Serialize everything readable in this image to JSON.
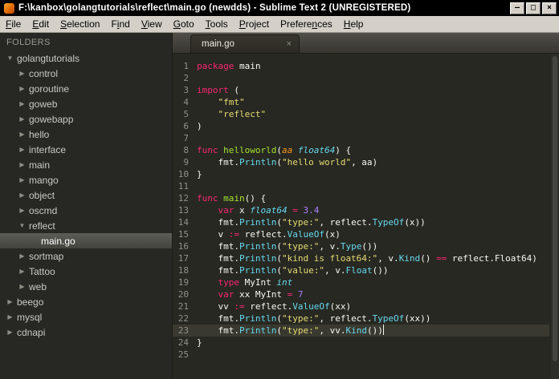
{
  "titlebar": {
    "title": "F:\\kanbox\\golangtutorials\\reflect\\main.go (newdds) - Sublime Text 2 (UNREGISTERED)",
    "buttons": [
      {
        "name": "minimize",
        "glyph": "–"
      },
      {
        "name": "maximize",
        "glyph": "□"
      },
      {
        "name": "close",
        "glyph": "×"
      }
    ]
  },
  "menu": {
    "items": [
      {
        "label": "File",
        "underline": 0
      },
      {
        "label": "Edit",
        "underline": 0
      },
      {
        "label": "Selection",
        "underline": 0
      },
      {
        "label": "Find",
        "underline": 1
      },
      {
        "label": "View",
        "underline": 0
      },
      {
        "label": "Goto",
        "underline": 0
      },
      {
        "label": "Tools",
        "underline": 0
      },
      {
        "label": "Project",
        "underline": 0
      },
      {
        "label": "Preferences",
        "underline": 7
      },
      {
        "label": "Help",
        "underline": 0
      }
    ]
  },
  "sidebar": {
    "header": "FOLDERS",
    "icons": {
      "expanded": "▼",
      "collapsed": "▶"
    },
    "items": [
      {
        "label": "golangtutorials",
        "level": 0,
        "state": "expanded",
        "type": "folder"
      },
      {
        "label": "control",
        "level": 1,
        "state": "collapsed",
        "type": "folder"
      },
      {
        "label": "goroutine",
        "level": 1,
        "state": "collapsed",
        "type": "folder"
      },
      {
        "label": "goweb",
        "level": 1,
        "state": "collapsed",
        "type": "folder"
      },
      {
        "label": "gowebapp",
        "level": 1,
        "state": "collapsed",
        "type": "folder"
      },
      {
        "label": "hello",
        "level": 1,
        "state": "collapsed",
        "type": "folder"
      },
      {
        "label": "interface",
        "level": 1,
        "state": "collapsed",
        "type": "folder"
      },
      {
        "label": "main",
        "level": 1,
        "state": "collapsed",
        "type": "folder"
      },
      {
        "label": "mango",
        "level": 1,
        "state": "collapsed",
        "type": "folder"
      },
      {
        "label": "object",
        "level": 1,
        "state": "collapsed",
        "type": "folder"
      },
      {
        "label": "oscmd",
        "level": 1,
        "state": "collapsed",
        "type": "folder"
      },
      {
        "label": "reflect",
        "level": 1,
        "state": "expanded",
        "type": "folder"
      },
      {
        "label": "main.go",
        "level": 2,
        "state": "none",
        "type": "file",
        "selected": true
      },
      {
        "label": "sortmap",
        "level": 1,
        "state": "collapsed",
        "type": "folder"
      },
      {
        "label": "Tattoo",
        "level": 1,
        "state": "collapsed",
        "type": "folder"
      },
      {
        "label": "web",
        "level": 1,
        "state": "collapsed",
        "type": "folder"
      },
      {
        "label": "beego",
        "level": 0,
        "state": "collapsed",
        "type": "folder"
      },
      {
        "label": "mysql",
        "level": 0,
        "state": "collapsed",
        "type": "folder"
      },
      {
        "label": "cdnapi",
        "level": 0,
        "state": "collapsed",
        "type": "folder"
      }
    ]
  },
  "editor": {
    "tabs": [
      {
        "label": "main.go",
        "active": true
      }
    ],
    "tab_close_glyph": "×",
    "lines": [
      {
        "n": 1,
        "segs": [
          [
            "package",
            "kw"
          ],
          [
            " main",
            "pl"
          ]
        ]
      },
      {
        "n": 2,
        "segs": []
      },
      {
        "n": 3,
        "segs": [
          [
            "import",
            "kw"
          ],
          [
            " (",
            "pl"
          ]
        ]
      },
      {
        "n": 4,
        "segs": [
          [
            "    ",
            "pl"
          ],
          [
            "\"fmt\"",
            "str"
          ]
        ]
      },
      {
        "n": 5,
        "segs": [
          [
            "    ",
            "pl"
          ],
          [
            "\"reflect\"",
            "str"
          ]
        ]
      },
      {
        "n": 6,
        "segs": [
          [
            ")",
            "pl"
          ]
        ]
      },
      {
        "n": 7,
        "segs": []
      },
      {
        "n": 8,
        "segs": [
          [
            "func",
            "kw"
          ],
          [
            " ",
            "pl"
          ],
          [
            "helloworld",
            "fn"
          ],
          [
            "(",
            "pl"
          ],
          [
            "aa",
            "par"
          ],
          [
            " ",
            "pl"
          ],
          [
            "float64",
            "typ"
          ],
          [
            ") {",
            "pl"
          ]
        ]
      },
      {
        "n": 9,
        "segs": [
          [
            "    fmt.",
            "pl"
          ],
          [
            "Println",
            "sup"
          ],
          [
            "(",
            "pl"
          ],
          [
            "\"hello world\"",
            "str"
          ],
          [
            ", aa)",
            "pl"
          ]
        ]
      },
      {
        "n": 10,
        "segs": [
          [
            "}",
            "pl"
          ]
        ]
      },
      {
        "n": 11,
        "segs": []
      },
      {
        "n": 12,
        "segs": [
          [
            "func",
            "kw"
          ],
          [
            " ",
            "pl"
          ],
          [
            "main",
            "fn"
          ],
          [
            "() {",
            "pl"
          ]
        ]
      },
      {
        "n": 13,
        "segs": [
          [
            "    ",
            "pl"
          ],
          [
            "var",
            "kw"
          ],
          [
            " x ",
            "pl"
          ],
          [
            "float64",
            "typ"
          ],
          [
            " ",
            "pl"
          ],
          [
            "=",
            "kw"
          ],
          [
            " ",
            "pl"
          ],
          [
            "3.4",
            "num"
          ]
        ]
      },
      {
        "n": 14,
        "segs": [
          [
            "    fmt.",
            "pl"
          ],
          [
            "Println",
            "sup"
          ],
          [
            "(",
            "pl"
          ],
          [
            "\"type:\"",
            "str"
          ],
          [
            ", reflect.",
            "pl"
          ],
          [
            "TypeOf",
            "sup"
          ],
          [
            "(x))",
            "pl"
          ]
        ]
      },
      {
        "n": 15,
        "segs": [
          [
            "    v ",
            "pl"
          ],
          [
            ":=",
            "kw"
          ],
          [
            " reflect.",
            "pl"
          ],
          [
            "ValueOf",
            "sup"
          ],
          [
            "(x)",
            "pl"
          ]
        ]
      },
      {
        "n": 16,
        "segs": [
          [
            "    fmt.",
            "pl"
          ],
          [
            "Println",
            "sup"
          ],
          [
            "(",
            "pl"
          ],
          [
            "\"type:\"",
            "str"
          ],
          [
            ", v.",
            "pl"
          ],
          [
            "Type",
            "sup"
          ],
          [
            "())",
            "pl"
          ]
        ]
      },
      {
        "n": 17,
        "segs": [
          [
            "    fmt.",
            "pl"
          ],
          [
            "Println",
            "sup"
          ],
          [
            "(",
            "pl"
          ],
          [
            "\"kind is float64:\"",
            "str"
          ],
          [
            ", v.",
            "pl"
          ],
          [
            "Kind",
            "sup"
          ],
          [
            "() ",
            "pl"
          ],
          [
            "==",
            "kw"
          ],
          [
            " reflect.Float64)",
            "pl"
          ]
        ]
      },
      {
        "n": 18,
        "segs": [
          [
            "    fmt.",
            "pl"
          ],
          [
            "Println",
            "sup"
          ],
          [
            "(",
            "pl"
          ],
          [
            "\"value:\"",
            "str"
          ],
          [
            ", v.",
            "pl"
          ],
          [
            "Float",
            "sup"
          ],
          [
            "())",
            "pl"
          ]
        ]
      },
      {
        "n": 19,
        "segs": [
          [
            "    ",
            "pl"
          ],
          [
            "type",
            "kw"
          ],
          [
            " MyInt ",
            "pl"
          ],
          [
            "int",
            "typ"
          ]
        ]
      },
      {
        "n": 20,
        "segs": [
          [
            "    ",
            "pl"
          ],
          [
            "var",
            "kw"
          ],
          [
            " xx MyInt ",
            "pl"
          ],
          [
            "=",
            "kw"
          ],
          [
            " ",
            "pl"
          ],
          [
            "7",
            "num"
          ]
        ]
      },
      {
        "n": 21,
        "segs": [
          [
            "    vv ",
            "pl"
          ],
          [
            ":=",
            "kw"
          ],
          [
            " reflect.",
            "pl"
          ],
          [
            "ValueOf",
            "sup"
          ],
          [
            "(xx)",
            "pl"
          ]
        ]
      },
      {
        "n": 22,
        "segs": [
          [
            "    fmt.",
            "pl"
          ],
          [
            "Println",
            "sup"
          ],
          [
            "(",
            "pl"
          ],
          [
            "\"type:\"",
            "str"
          ],
          [
            ", reflect.",
            "pl"
          ],
          [
            "TypeOf",
            "sup"
          ],
          [
            "(xx))",
            "pl"
          ]
        ]
      },
      {
        "n": 23,
        "segs": [
          [
            "    fmt.",
            "pl"
          ],
          [
            "Println",
            "sup"
          ],
          [
            "(",
            "pl"
          ],
          [
            "\"type:\"",
            "str"
          ],
          [
            ", vv.",
            "pl"
          ],
          [
            "Kind",
            "sup"
          ],
          [
            "())",
            "pl"
          ]
        ],
        "current": true,
        "caret": true
      },
      {
        "n": 24,
        "segs": [
          [
            "}",
            "pl"
          ]
        ]
      },
      {
        "n": 25,
        "segs": []
      }
    ]
  },
  "colors": {
    "editor_background": "#272822",
    "keyword": "#f92672",
    "string": "#e6db74",
    "number": "#ae81ff",
    "type": "#66d9ef",
    "function": "#a6e22e",
    "parameter": "#fd971f",
    "plain_text": "#f8f8f2",
    "line_number": "#8f908a",
    "current_line": "#3a392f",
    "titlebar_background": "#000000",
    "menubar_background": "#d4d0c8"
  }
}
